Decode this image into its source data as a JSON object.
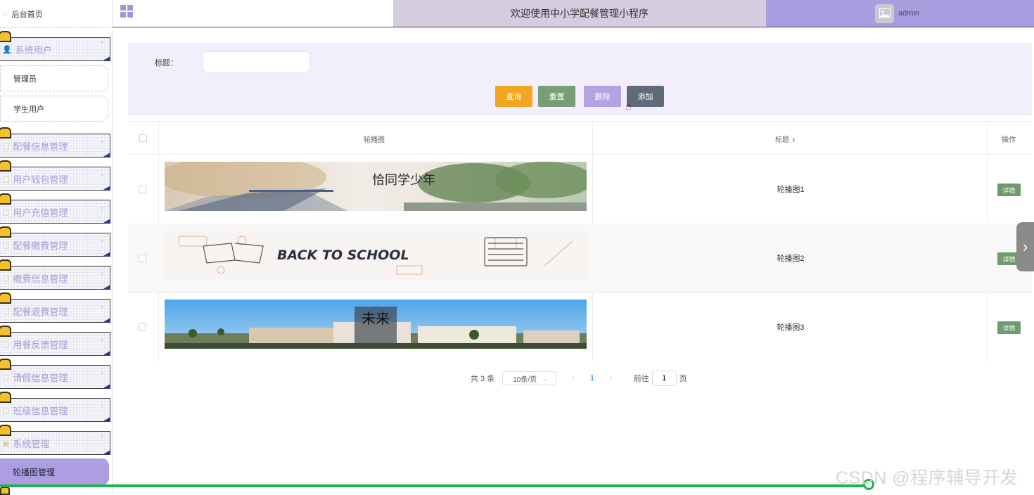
{
  "sidebar": {
    "home": "后台首页",
    "menus": [
      {
        "label": "系统用户"
      },
      {
        "label": "配餐信息管理"
      },
      {
        "label": "用户钱包管理"
      },
      {
        "label": "用户充值管理"
      },
      {
        "label": "配餐缴费管理"
      },
      {
        "label": "缴费信息管理"
      },
      {
        "label": "配餐退费管理"
      },
      {
        "label": "用餐反馈管理"
      },
      {
        "label": "请假信息管理"
      },
      {
        "label": "班级信息管理"
      },
      {
        "label": "系统管理"
      }
    ],
    "sub_items": [
      "管理员",
      "学生用户"
    ],
    "active_item": "轮播图管理"
  },
  "header": {
    "title": "欢迎使用中小学配餐管理小程序",
    "username": "admin"
  },
  "search": {
    "label": "标题：",
    "value": "",
    "buttons": {
      "query": "查询",
      "reset": "重置",
      "delete": "删除",
      "add": "添加"
    }
  },
  "table": {
    "columns": {
      "image": "轮播图",
      "title": "标题",
      "action": "操作"
    },
    "rows": [
      {
        "title": "轮播图1",
        "action": "详情",
        "banner_text": "恰同学少年"
      },
      {
        "title": "轮播图2",
        "action": "详情",
        "banner_text": "BACK TO SCHOOL"
      },
      {
        "title": "轮播图3",
        "action": "详情",
        "banner_text": "未来"
      }
    ]
  },
  "pagination": {
    "total": "共 3 条",
    "page_size": "10条/页",
    "current_page": "1",
    "goto_label": "前往",
    "goto_value": "1",
    "goto_unit": "页"
  },
  "video_progress": 0.84,
  "watermark": "CSDN @程序辅导开发",
  "colors": {
    "accent": "#a99de0",
    "header_center": "#d4cde0",
    "query": "#f2a51f",
    "reset": "#789e79",
    "delete": "#b3a2e4",
    "add": "#5f6b7a",
    "detail": "#6f9b6f",
    "progress": "#22b14c"
  }
}
